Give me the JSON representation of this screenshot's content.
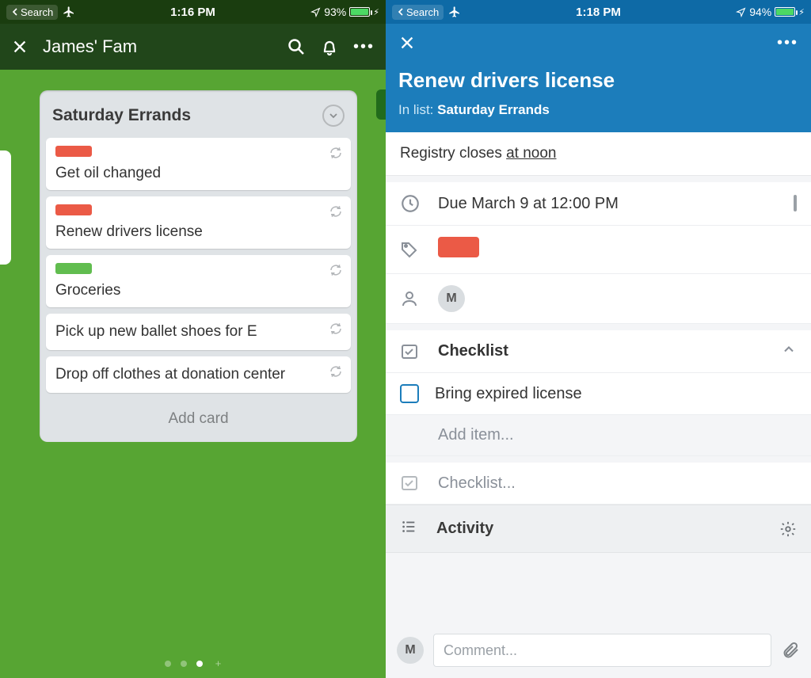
{
  "left": {
    "status": {
      "back": "Search",
      "time": "1:16 PM",
      "battery": "93%"
    },
    "board_title": "James' Fam",
    "list": {
      "name": "Saturday Errrands? -> Saturday Errands",
      "display_name": "Saturday Errands",
      "add_label": "Add card",
      "cards": [
        {
          "label_color": "red",
          "title": "Get oil changed"
        },
        {
          "label_color": "red",
          "title": "Renew drivers license"
        },
        {
          "label_color": "green",
          "title": "Groceries"
        },
        {
          "label_color": null,
          "title": "Pick up new ballet shoes for E"
        },
        {
          "label_color": null,
          "title": "Drop off clothes at donation center"
        }
      ]
    }
  },
  "right": {
    "status": {
      "back": "Search",
      "time": "1:18 PM",
      "battery": "94%"
    },
    "card_title": "Renew drivers license",
    "in_list_prefix": "In list: ",
    "in_list_name": "Saturday Errands",
    "description_prefix": "Registry closes ",
    "description_underlined": "at noon",
    "due_text": "Due March 9 at 12:00 PM",
    "label_color": "#eb5a46",
    "member_initial": "M",
    "checklist_header": "Checklist",
    "checklist_items": [
      {
        "text": "Bring expired license",
        "checked": false
      }
    ],
    "add_item_placeholder": "Add item...",
    "add_checklist_placeholder": "Checklist...",
    "activity_header": "Activity",
    "comment_placeholder": "Comment...",
    "comment_avatar": "M"
  }
}
